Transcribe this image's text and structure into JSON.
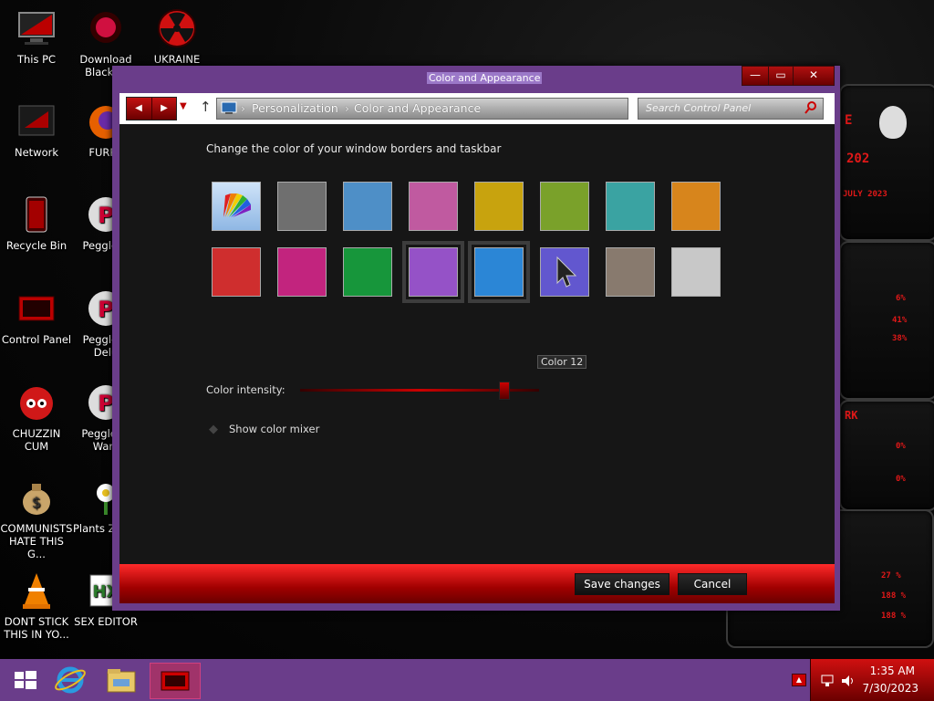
{
  "desktop_icons": [
    {
      "label": "This PC"
    },
    {
      "label": "Download Black ..."
    },
    {
      "label": "UKRAINE"
    },
    {
      "label": "Network"
    },
    {
      "label": "FURRY"
    },
    {
      "label": "Recycle Bin"
    },
    {
      "label": "Peggle D"
    },
    {
      "label": "Control Panel"
    },
    {
      "label": "Peggle N Delu"
    },
    {
      "label": "CHUZZIN CUM"
    },
    {
      "label": "Peggle of Warc"
    },
    {
      "label": "COMMUNISTS HATE THIS G..."
    },
    {
      "label": "Plants Zomb"
    },
    {
      "label": "DONT STICK THIS IN YO..."
    },
    {
      "label": "SEX EDITOR"
    }
  ],
  "hud": {
    "title_fragment": "E",
    "number": "202",
    "date": "JULY 2023",
    "stat1": "6%",
    "stat2": "41%",
    "stat3": "38%",
    "code": "RK",
    "stat4": "0%",
    "stat5": "0%",
    "stat6": "27 %",
    "stat7": "188 %",
    "stat8": "188 %"
  },
  "window": {
    "title": "Color and Appearance",
    "minimize": "—",
    "maximize": "▭",
    "close": "✕"
  },
  "nav": {
    "back_icon": "◀",
    "forward_icon": "▶",
    "recent_icon": "▼",
    "up_icon": "↑",
    "breadcrumb": [
      "Personalization",
      "Color and Appearance"
    ],
    "separator": "›",
    "search_placeholder": "Search Control Panel",
    "search_icon": "magnifier-icon"
  },
  "content": {
    "heading": "Change the color of your window borders and taskbar",
    "swatches_row1": [
      "#ffffff",
      "#6f6f6f",
      "#4e8fc7",
      "#c05aa0",
      "#c8a30e",
      "#7aa12a",
      "#3aa3a2",
      "#d7851c"
    ],
    "swatches_row2": [
      "#cf2e2e",
      "#c2247e",
      "#17963b",
      "#9552c7",
      "#2b86d6",
      "#6257cf",
      "#887a6e",
      "#c8c8c8"
    ],
    "tooltip": "Color 12",
    "intensity_label": "Color intensity:",
    "intensity_value": 0.85,
    "mixer_label": "Show color mixer"
  },
  "footer": {
    "save": "Save changes",
    "cancel": "Cancel"
  },
  "taskbar": {
    "clock_time": "1:35 AM",
    "clock_date": "7/30/2023"
  },
  "colors": {
    "accent": "#6a3d8a",
    "brand_red": "#c00000"
  }
}
